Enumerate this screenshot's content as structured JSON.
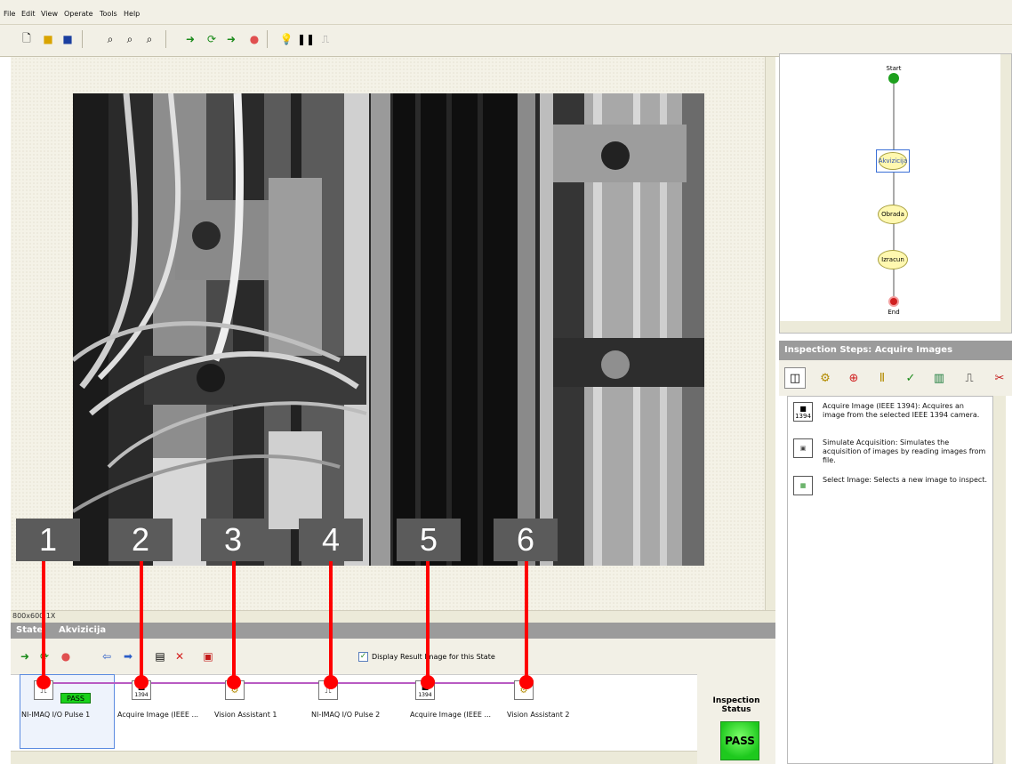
{
  "menu": [
    "File",
    "Edit",
    "View",
    "Operate",
    "Tools",
    "Help"
  ],
  "zoom_label": "800x600 1X",
  "state_bar": {
    "label": "State",
    "name": "Akvizicija"
  },
  "display_result_label": "Display Result Image for this State",
  "steps": [
    {
      "label": "NI-IMAQ I/O Pulse 1",
      "icon": "io-pulse-icon",
      "badge": "PASS"
    },
    {
      "label": "Acquire Image (IEEE ...",
      "icon": "camera-1394-icon",
      "sub": "1394"
    },
    {
      "label": "Vision Assistant 1",
      "icon": "vision-assistant-icon"
    },
    {
      "label": "NI-IMAQ I/O Pulse 2",
      "icon": "io-pulse-icon"
    },
    {
      "label": "Acquire Image (IEEE ...",
      "icon": "camera-1394-icon",
      "sub": "1394"
    },
    {
      "label": "Vision Assistant 2",
      "icon": "vision-assistant-icon"
    }
  ],
  "callouts": [
    "1",
    "2",
    "3",
    "4",
    "5",
    "6"
  ],
  "inspection_status": {
    "title": "Inspection Status",
    "value": "PASS"
  },
  "flow": {
    "start": "Start",
    "node1": "Akvizicija",
    "node2": "Obrada",
    "node3": "Izracun",
    "end": "End"
  },
  "inspection_steps": {
    "header": "Inspection Steps: Acquire Images",
    "items": [
      {
        "text": "Acquire Image (IEEE 1394): Acquires an image from the selected IEEE 1394 camera.",
        "icon_sub": "1394"
      },
      {
        "text": "Simulate Acquisition: Simulates the acquisition of images by reading images from file."
      },
      {
        "text": "Select Image: Selects a new image to inspect."
      }
    ]
  },
  "colors": {
    "pass_green": "#22cc22",
    "callout_red": "#ff0000",
    "wire_purple": "#b85bc2",
    "panel_grey": "#9b9b9b"
  }
}
